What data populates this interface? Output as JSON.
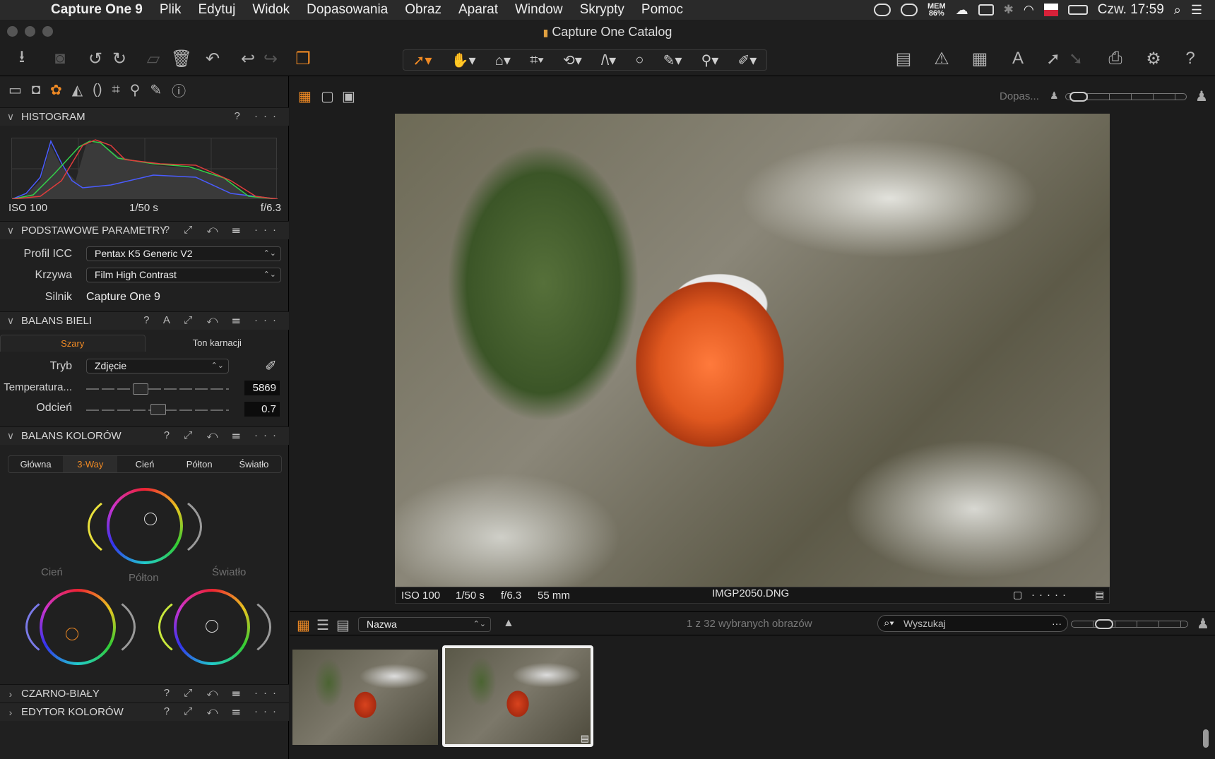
{
  "menubar": {
    "app": "Capture One 9",
    "items": [
      "Plik",
      "Edytuj",
      "Widok",
      "Dopasowania",
      "Obraz",
      "Aparat",
      "Window",
      "Skrypty",
      "Pomoc"
    ],
    "mem_label": "MEM",
    "mem_value": "86%",
    "clock": "Czw. 17:59"
  },
  "window": {
    "title": "Capture One Catalog"
  },
  "histogram": {
    "title": "HISTOGRAM",
    "iso": "ISO 100",
    "shutter": "1/50 s",
    "aperture": "f/6.3"
  },
  "basic": {
    "title": "PODSTAWOWE PARAMETRY",
    "icc_label": "Profil ICC",
    "icc_value": "Pentax K5 Generic V2",
    "curve_label": "Krzywa",
    "curve_value": "Film High Contrast",
    "engine_label": "Silnik",
    "engine_value": "Capture One 9"
  },
  "wb": {
    "title": "BALANS BIELI",
    "auto_glyph": "A",
    "tab1": "Szary",
    "tab2": "Ton karnacji",
    "mode_label": "Tryb",
    "mode_value": "Zdjęcie",
    "temp_label": "Temperatura...",
    "temp_value": "5869",
    "tint_label": "Odcień",
    "tint_value": "0.7"
  },
  "cb": {
    "title": "BALANS KOLORÓW",
    "tabs": [
      "Główna",
      "3-Way",
      "Cień",
      "Półton",
      "Światło"
    ],
    "active_tab": 1,
    "shadow_label": "Cień",
    "mid_label": "Półton",
    "high_label": "Światło"
  },
  "bw": {
    "title": "CZARNO-BIAŁY"
  },
  "ce": {
    "title": "EDYTOR KOLORÓW"
  },
  "viewer": {
    "adjust_label": "Dopas...",
    "iso": "ISO 100",
    "shutter": "1/50 s",
    "aperture": "f/6.3",
    "focal": "55 mm",
    "filename": "IMGP2050.DNG"
  },
  "browser": {
    "sort_value": "Nazwa",
    "count_text": "1 z 32 wybranych obrazów",
    "search_placeholder": "Wyszukaj",
    "thumbnails": [
      {
        "selected": false
      },
      {
        "selected": true
      }
    ]
  },
  "colors": {
    "accent": "#f08a24",
    "panel": "#202020",
    "background": "#1a1a1a"
  }
}
